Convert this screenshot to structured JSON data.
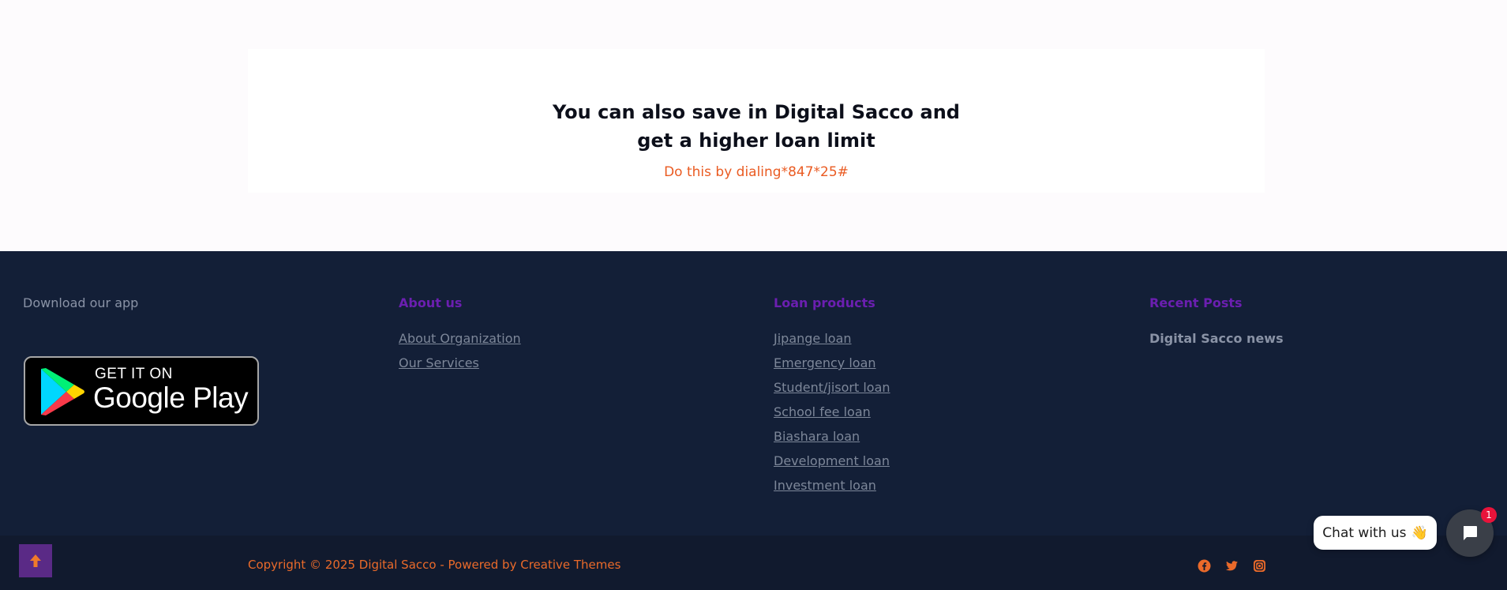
{
  "promo": {
    "title_line1": "You can also save in Digital Sacco and",
    "title_line2": "get a higher loan limit",
    "subtitle": "Do this by dialing*847*25#"
  },
  "footer": {
    "app": {
      "heading": "Download our app",
      "badge_small": "GET IT ON",
      "badge_big": "Google Play"
    },
    "about": {
      "heading": "About us",
      "links": [
        "About Organization",
        "Our Services"
      ]
    },
    "loans": {
      "heading": "Loan products",
      "links": [
        "Jipange loan",
        "Emergency loan",
        "Student/jisort loan",
        "School fee loan",
        "Biashara loan",
        "Development loan",
        "Investment loan"
      ]
    },
    "posts": {
      "heading": "Recent Posts",
      "items": [
        "Digital Sacco news"
      ]
    }
  },
  "bottom": {
    "copyright": "Copyright © 2025 Digital Sacco - Powered by Creative Themes",
    "socials": [
      "facebook-icon",
      "twitter-icon",
      "instagram-icon"
    ]
  },
  "chat": {
    "label": "Chat with us",
    "emoji": "👋",
    "badge_count": "1"
  },
  "colors": {
    "accent_orange": "#ea5b22",
    "heading_purple": "#6b1fb0",
    "footer_bg": "#131f37"
  }
}
